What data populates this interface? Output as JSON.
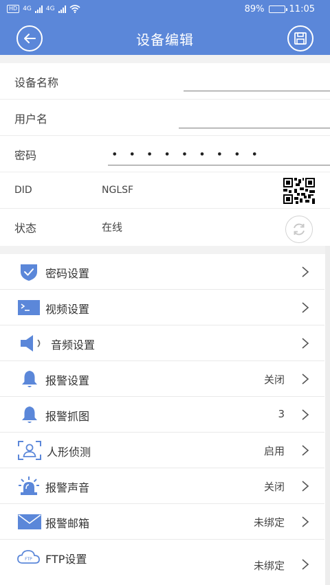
{
  "status_bar": {
    "hd_badge": "HD",
    "network_1": "4G",
    "network_2": "4G",
    "battery_text": "89%",
    "battery_level_percent": 89,
    "time": "11:05"
  },
  "header": {
    "title": "设备编辑",
    "back_icon": "back-arrow-icon",
    "save_icon": "save-disk-icon",
    "accent_color": "#5b87d9"
  },
  "device_info": {
    "name_label": "设备名称",
    "name_value": "",
    "username_label": "用户名",
    "username_value": "",
    "password_label": "密码",
    "password_mask": "•••••••••",
    "did_label": "DID",
    "did_value": "NGLSF",
    "status_label": "状态",
    "status_value": "在线",
    "qr_icon": "qr-code-icon",
    "refresh_icon": "refresh-icon"
  },
  "settings": [
    {
      "label": "密码设置",
      "value": "",
      "icon": "shield-check-icon"
    },
    {
      "label": "视频设置",
      "value": "",
      "icon": "terminal-video-icon"
    },
    {
      "label": "音频设置",
      "value": "",
      "icon": "speaker-icon"
    },
    {
      "label": "报警设置",
      "value": "关闭",
      "icon": "bell-icon"
    },
    {
      "label": "报警抓图",
      "value": "3",
      "icon": "bell-icon"
    },
    {
      "label": "人形侦测",
      "value": "启用",
      "icon": "human-detect-icon"
    },
    {
      "label": "报警声音",
      "value": "关闭",
      "icon": "siren-icon"
    },
    {
      "label": "报警邮箱",
      "value": "未绑定",
      "icon": "envelope-icon"
    },
    {
      "label": "FTP设置",
      "value": "未绑定",
      "icon": "ftp-cloud-icon"
    }
  ]
}
